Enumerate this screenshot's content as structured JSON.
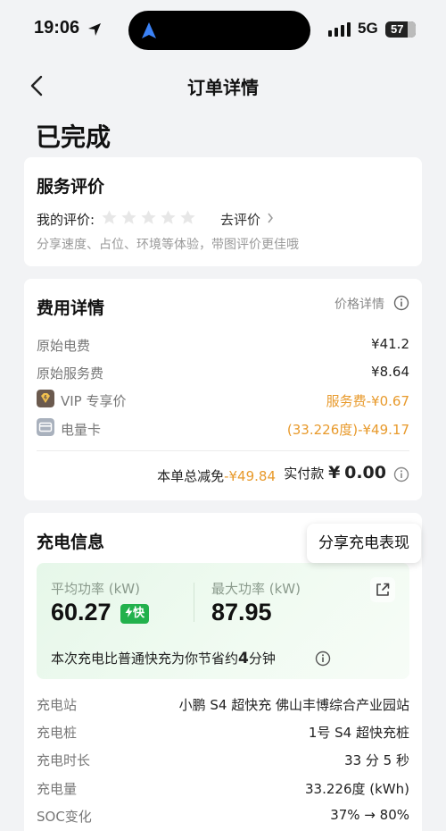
{
  "status_bar": {
    "time": "19:06",
    "network": "5G",
    "battery": "57"
  },
  "nav": {
    "title": "订单详情"
  },
  "order_status": "已完成",
  "rating": {
    "title": "服务评价",
    "my_rating_label": "我的评价:",
    "star_count": 5,
    "go_rate_label": "去评价",
    "hint": "分享速度、占位、环境等体验，带图评价更佳哦"
  },
  "fees": {
    "title": "费用详情",
    "detail_link": "价格详情",
    "rows": [
      {
        "label": "原始电费",
        "value": "¥41.2"
      },
      {
        "label": "原始服务费",
        "value": "¥8.64"
      },
      {
        "label": "VIP 专享价",
        "value": "服务费-¥0.67"
      },
      {
        "label": "电量卡",
        "value": "(33.226度)-¥49.17"
      }
    ],
    "total_reduce_label": "本单总减免",
    "total_reduce_value": "-¥49.84",
    "paid_label": "实付款",
    "paid_currency": "¥",
    "paid_value": "0.00"
  },
  "charging": {
    "title": "充电信息",
    "share_tooltip": "分享充电表现",
    "avg_power_label": "平均功率 (kW)",
    "avg_power_value": "60.27",
    "fast_badge": "快",
    "max_power_label": "最大功率 (kW)",
    "max_power_value": "87.95",
    "saving_prefix": "本次充电比普通快充为你节省约",
    "saving_minutes": "4",
    "saving_suffix": "分钟",
    "rows": [
      {
        "label": "充电站",
        "value": "小鹏 S4 超快充 佛山丰博综合产业园站"
      },
      {
        "label": "充电桩",
        "value": "1号 S4 超快充桩"
      },
      {
        "label": "充电时长",
        "value": "33 分 5 秒"
      },
      {
        "label": "充电量",
        "value": "33.226度 (kWh)"
      },
      {
        "label": "SOC变化",
        "value": "37% → 80%"
      }
    ]
  },
  "colors": {
    "accent_orange": "#e89a2c",
    "fast_green": "#22b14c",
    "vip_icon": "#6b5a4e",
    "card_icon": "#a9b1bd"
  }
}
